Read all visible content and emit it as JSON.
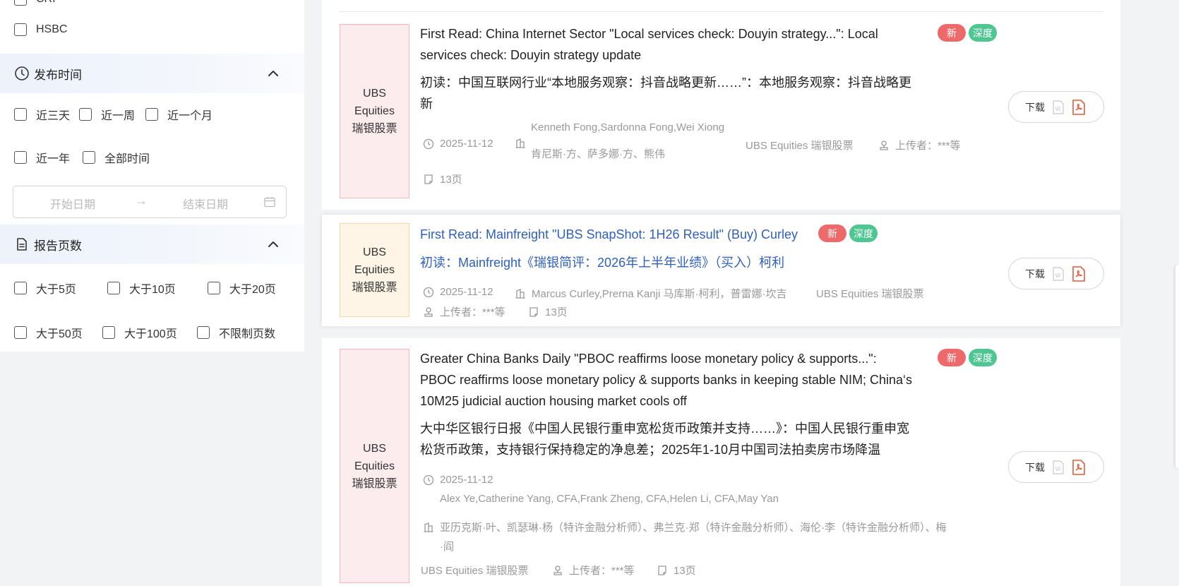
{
  "sidebar": {
    "org_filters": [
      {
        "label": "CRI"
      },
      {
        "label": "HSBC"
      }
    ],
    "publish_time": {
      "title": "发布时间",
      "options": [
        "近三天",
        "近一周",
        "近一个月",
        "近一年",
        "全部时间"
      ],
      "start_placeholder": "开始日期",
      "end_placeholder": "结束日期"
    },
    "page_count": {
      "title": "报告页数",
      "options": [
        "大于5页",
        "大于10页",
        "大于20页",
        "大于50页",
        "大于100页",
        "不限制页数"
      ]
    }
  },
  "reports": [
    {
      "thumb": [
        "UBS",
        "Equities",
        "瑞银股票"
      ],
      "title_en": [
        "First Read: China Internet Sector \"Local services check: Douyin strategy...\": Local",
        "services check: Douyin strategy update"
      ],
      "title_cn": [
        "初读：中国互联网行业“本地服务观察：抖音战略更新……”：本地服务观察：抖音战略更",
        "新"
      ],
      "badge_new": "新",
      "badge_deep": "深度",
      "date": "2025-11-12",
      "authors_en": "Kenneth Fong,Sardonna Fong,Wei Xiong",
      "authors_cn": "肯尼斯·方、萨多娜·方、熊伟",
      "org": "UBS Equities 瑞银股票",
      "uploader": "上传者：***等",
      "pages": "13页",
      "download": "下载"
    },
    {
      "thumb": [
        "UBS",
        "Equities",
        "瑞银股票"
      ],
      "title_en": [
        "First Read: Mainfreight \"UBS SnapShot: 1H26 Result\" (Buy) Curley"
      ],
      "title_cn": [
        "初读：Mainfreight《瑞银简评：2026年上半年业绩》（买入）柯利"
      ],
      "badge_new": "新",
      "badge_deep": "深度",
      "date": "2025-11-12",
      "authors": "Marcus Curley,Prerna Kanji 马库斯·柯利，普雷娜·坎吉",
      "org": "UBS Equities 瑞银股票",
      "uploader": "上传者：***等",
      "pages": "13页",
      "download": "下载"
    },
    {
      "thumb": [
        "UBS",
        "Equities",
        "瑞银股票"
      ],
      "title_en": [
        "Greater China Banks Daily \"PBOC reaffirms loose monetary policy & supports...\":",
        "PBOC reaffirms loose monetary policy & supports banks in keeping stable NIM; China‘s",
        "10M25 judicial auction housing market cools off"
      ],
      "title_cn": [
        "大中华区银行日报《中国人民银行重申宽松货币政策并支持……》：中国人民银行重申宽",
        "松货币政策，支持银行保持稳定的净息差；2025年1-10月中国司法拍卖房市场降温"
      ],
      "badge_new": "新",
      "badge_deep": "深度",
      "date": "2025-11-12",
      "authors_en": "Alex Ye,Catherine Yang, CFA,Frank Zheng, CFA,Helen Li, CFA,May Yan",
      "authors_cn": [
        "亚历克斯·叶、凯瑟琳·杨（特许金融分析师）、弗兰克·郑（特许金融分析师）、海伦·李（特许金融分析师）、梅",
        "·阎"
      ],
      "org": "UBS Equities 瑞银股票",
      "uploader": "上传者：***等",
      "pages": "13页",
      "download": "下载"
    }
  ]
}
